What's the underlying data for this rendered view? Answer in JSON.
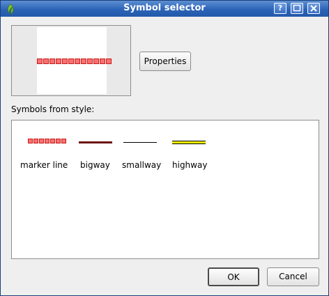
{
  "window": {
    "title": "Symbol selector",
    "buttons": {
      "help": "?",
      "maximize": "□",
      "close": "✕"
    }
  },
  "preview": {
    "symbol": "marker line",
    "marker_fill": "#ff7070",
    "marker_stroke": "#c21d1d"
  },
  "properties_button": {
    "label": "Properties"
  },
  "style_section": {
    "label": "Symbols from style:"
  },
  "symbols": [
    {
      "name": "marker line",
      "kind": "marker-line"
    },
    {
      "name": "bigway",
      "kind": "bigway",
      "color": "#6b0f0f"
    },
    {
      "name": "smallway",
      "kind": "smallway",
      "color": "#000000"
    },
    {
      "name": "highway",
      "kind": "highway",
      "fill": "#f2f200",
      "casing": "#000000"
    }
  ],
  "footer": {
    "ok_label": "OK",
    "cancel_label": "Cancel"
  }
}
